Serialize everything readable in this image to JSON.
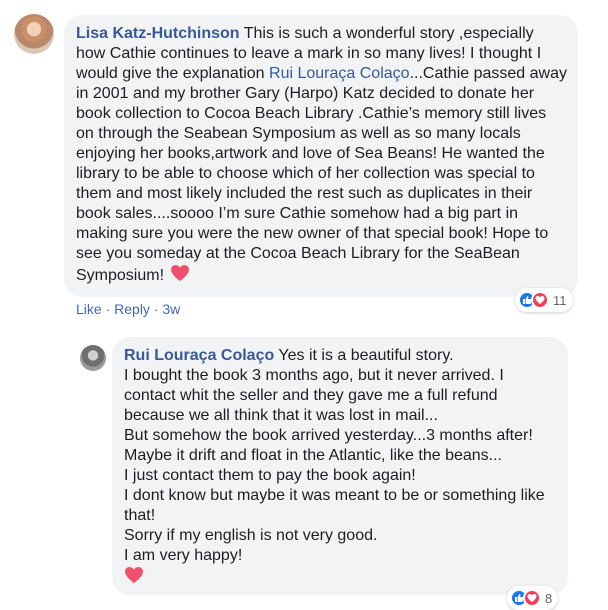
{
  "comment1": {
    "author": "Lisa Katz-Hutchinson",
    "lines": [
      " This is such a wonderful story ,especially",
      "how Cathie continues to leave a mark in so many lives! I thought I",
      "would give the explanation ",
      "in 2001 and my brother Gary (Harpo) Katz decided to donate her",
      "book collection to Cocoa Beach Library .Cathie’s memory still lives",
      "on through the Seabean Symposium as well as so many locals",
      "enjoying her books,artwork and love of Sea Beans! He wanted the",
      "library to be able to choose which of her collection was special to",
      "them and most likely included the rest such as duplicates in their",
      "book sales....soooo I’m sure Cathie somehow had a big part in",
      "making sure you were the new owner of that special book! Hope to",
      "see you someday at the Cocoa Beach Library for the SeaBean",
      "Symposium!"
    ],
    "mention": "Rui Louraça Colaço",
    "after_mention": "...Cathie passed away",
    "reaction_count": "11",
    "actions": {
      "like": "Like",
      "reply": "Reply",
      "separator": "·",
      "time": "3w"
    }
  },
  "comment2": {
    "author": "Rui Louraça Colaço",
    "first_line": " Yes it is a beautiful story.",
    "lines": [
      "I bought the book 3 months ago, but it never arrived. I",
      "contact whit the seller and they gave me a full refund",
      "because we all think that it was lost in mail...",
      "But somehow the book arrived yesterday...3 months after!",
      "Maybe it drift and float in the Atlantic, like the beans...",
      "I just contact them to pay the book again!",
      "I dont know but maybe it was meant to be or something like",
      "that!",
      "Sorry if my english is not very good.",
      "I am very happy!"
    ],
    "reaction_count": "8"
  },
  "icons": {
    "heart": "heart-icon",
    "like_reaction": "like-reaction-icon",
    "love_reaction": "love-reaction-icon"
  },
  "colors": {
    "author": "#385898",
    "bubble": "#f2f3f5",
    "link": "#4267b2",
    "heart": "#f0506e",
    "like": "#1877f2",
    "love": "#f33e58"
  }
}
